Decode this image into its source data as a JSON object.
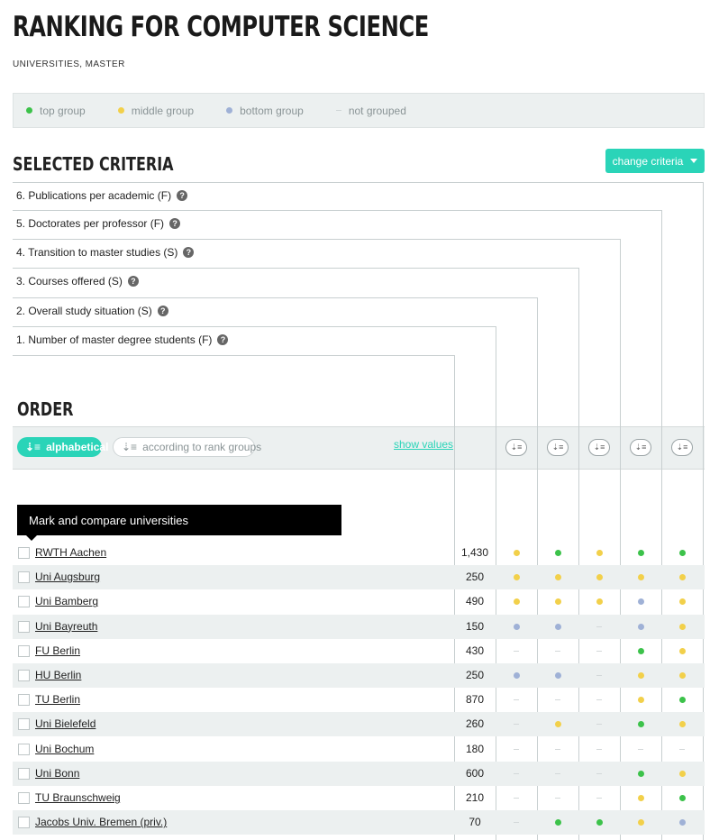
{
  "header": {
    "title": "RANKING FOR COMPUTER SCIENCE",
    "subtitle": "UNIVERSITIES, MASTER"
  },
  "colors": {
    "accent": "#2ad4b8",
    "top": "#3cc24a",
    "middle": "#f2d04a",
    "bottom": "#9fb1d6",
    "none": "#d3d8d9"
  },
  "legend": [
    {
      "label": "top group",
      "group": "top"
    },
    {
      "label": "middle group",
      "group": "middle"
    },
    {
      "label": "bottom group",
      "group": "bottom"
    },
    {
      "label": "not grouped",
      "group": "none"
    }
  ],
  "criteria_section": {
    "title": "SELECTED CRITERIA",
    "change_label": "change criteria",
    "criteria": [
      {
        "label": "6. Publications per academic (F)"
      },
      {
        "label": "5. Doctorates per professor (F)"
      },
      {
        "label": "4. Transition to master studies (S)"
      },
      {
        "label": "3. Courses offered (S)"
      },
      {
        "label": "2. Overall study situation (S)"
      },
      {
        "label": "1. Number of master degree students (F)"
      }
    ]
  },
  "order": {
    "title": "ORDER",
    "alphabetical_label": "alphabetical",
    "rank_groups_label": "according to rank groups",
    "show_values_label": "show values",
    "sort_icon": "sort-icon"
  },
  "tooltip": "Mark and compare universities",
  "rows": [
    {
      "name": "RWTH Aachen",
      "students": "1,430",
      "groups": [
        "middle",
        "top",
        "middle",
        "top",
        "top"
      ]
    },
    {
      "name": "Uni Augsburg",
      "students": "250",
      "groups": [
        "middle",
        "middle",
        "middle",
        "middle",
        "middle"
      ]
    },
    {
      "name": "Uni Bamberg",
      "students": "490",
      "groups": [
        "middle",
        "middle",
        "middle",
        "bottom",
        "middle"
      ]
    },
    {
      "name": "Uni Bayreuth",
      "students": "150",
      "groups": [
        "bottom",
        "bottom",
        "none",
        "bottom",
        "middle"
      ]
    },
    {
      "name": "FU Berlin",
      "students": "430",
      "groups": [
        "none",
        "none",
        "none",
        "top",
        "middle"
      ]
    },
    {
      "name": "HU Berlin",
      "students": "250",
      "groups": [
        "bottom",
        "bottom",
        "none",
        "middle",
        "middle"
      ]
    },
    {
      "name": "TU Berlin",
      "students": "870",
      "groups": [
        "none",
        "none",
        "none",
        "middle",
        "top"
      ]
    },
    {
      "name": "Uni Bielefeld",
      "students": "260",
      "groups": [
        "none",
        "middle",
        "none",
        "top",
        "middle"
      ]
    },
    {
      "name": "Uni Bochum",
      "students": "180",
      "groups": [
        "none",
        "none",
        "none",
        "none",
        "none"
      ]
    },
    {
      "name": "Uni Bonn",
      "students": "600",
      "groups": [
        "none",
        "none",
        "none",
        "top",
        "middle"
      ]
    },
    {
      "name": "TU Braunschweig",
      "students": "210",
      "groups": [
        "none",
        "none",
        "none",
        "middle",
        "top"
      ]
    },
    {
      "name": "Jacobs Univ. Bremen (priv.)",
      "students": "70",
      "groups": [
        "none",
        "top",
        "top",
        "middle",
        "bottom"
      ]
    }
  ]
}
